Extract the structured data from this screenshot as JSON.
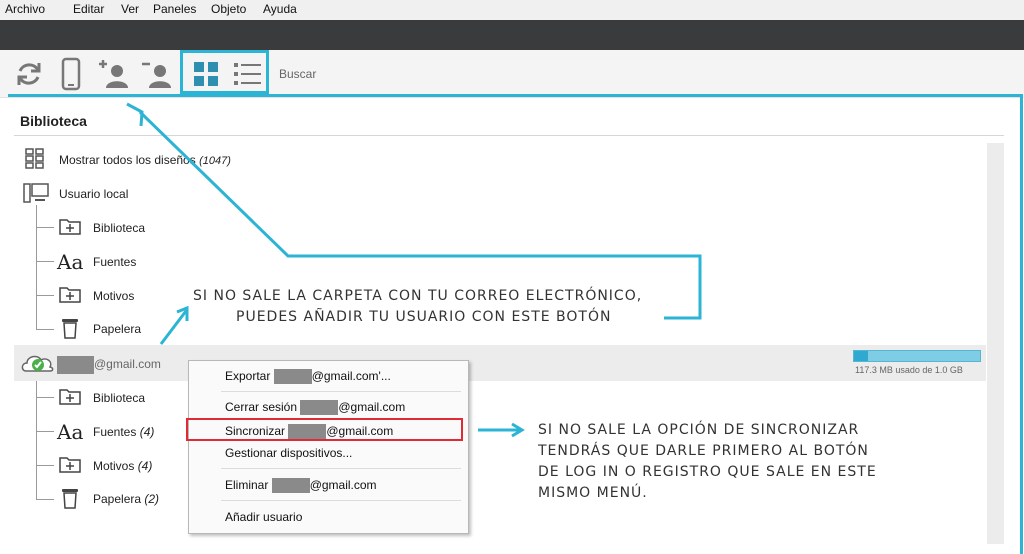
{
  "menubar": {
    "items": [
      "Archivo",
      "Editar",
      "Ver",
      "Paneles",
      "Objeto",
      "Ayuda"
    ]
  },
  "toolbar": {
    "icons": [
      "sync-icon",
      "device-icon",
      "add-user-icon",
      "remove-user-icon",
      "grid-view-icon",
      "list-view-icon"
    ],
    "search_label": "Buscar"
  },
  "library": {
    "title": "Biblioteca",
    "show_all": "Mostrar todos los diseños",
    "show_all_count": "(1047)",
    "local_user": "Usuario local",
    "local_items": [
      {
        "label": "Biblioteca",
        "icon": "folder-plus-icon",
        "count": ""
      },
      {
        "label": "Fuentes",
        "icon": "fonts-icon",
        "count": ""
      },
      {
        "label": "Motivos",
        "icon": "folder-plus-icon",
        "count": ""
      },
      {
        "label": "Papelera",
        "icon": "trash-icon",
        "count": ""
      }
    ],
    "account_suffix": "@gmail.com",
    "account_items": [
      {
        "label": "Biblioteca",
        "icon": "folder-plus-icon",
        "count": ""
      },
      {
        "label": "Fuentes",
        "icon": "fonts-icon",
        "count": "(4)"
      },
      {
        "label": "Motivos",
        "icon": "folder-plus-icon",
        "count": "(4)"
      },
      {
        "label": "Papelera",
        "icon": "trash-icon",
        "count": "(2)"
      }
    ],
    "storage_text": "117.3 MB usado de 1.0 GB",
    "storage_fraction": 0.11
  },
  "context_menu": {
    "export_prefix": "Exportar ",
    "export_suffix": "@gmail.com'...",
    "logout_prefix": "Cerrar sesión ",
    "logout_suffix": "@gmail.com",
    "sync_prefix": "Sincronizar ",
    "sync_suffix": "@gmail.com",
    "manage_devices": "Gestionar dispositivos...",
    "delete_prefix": "Eliminar ",
    "delete_suffix": "@gmail.com",
    "add_user": "Añadir usuario"
  },
  "annotations": {
    "note1_line1": "SI NO SALE LA CARPETA CON TU CORREO ELECTRÓNICO,",
    "note1_line2": "PUEDES AÑADIR TU USUARIO CON ESTE BOTÓN",
    "note2_line1": "SI NO SALE LA OPCIÓN DE SINCRONIZAR",
    "note2_line2": "TENDRÁS QUE DARLE PRIMERO AL BOTÓN",
    "note2_line3": "DE LOG IN O REGISTRO QUE SALE EN ESTE",
    "note2_line4": "MISMO MENÚ."
  },
  "colors": {
    "annotation": "#2bb4d4",
    "highlight": "#e02a35",
    "darkbar": "#3a3b3d"
  }
}
